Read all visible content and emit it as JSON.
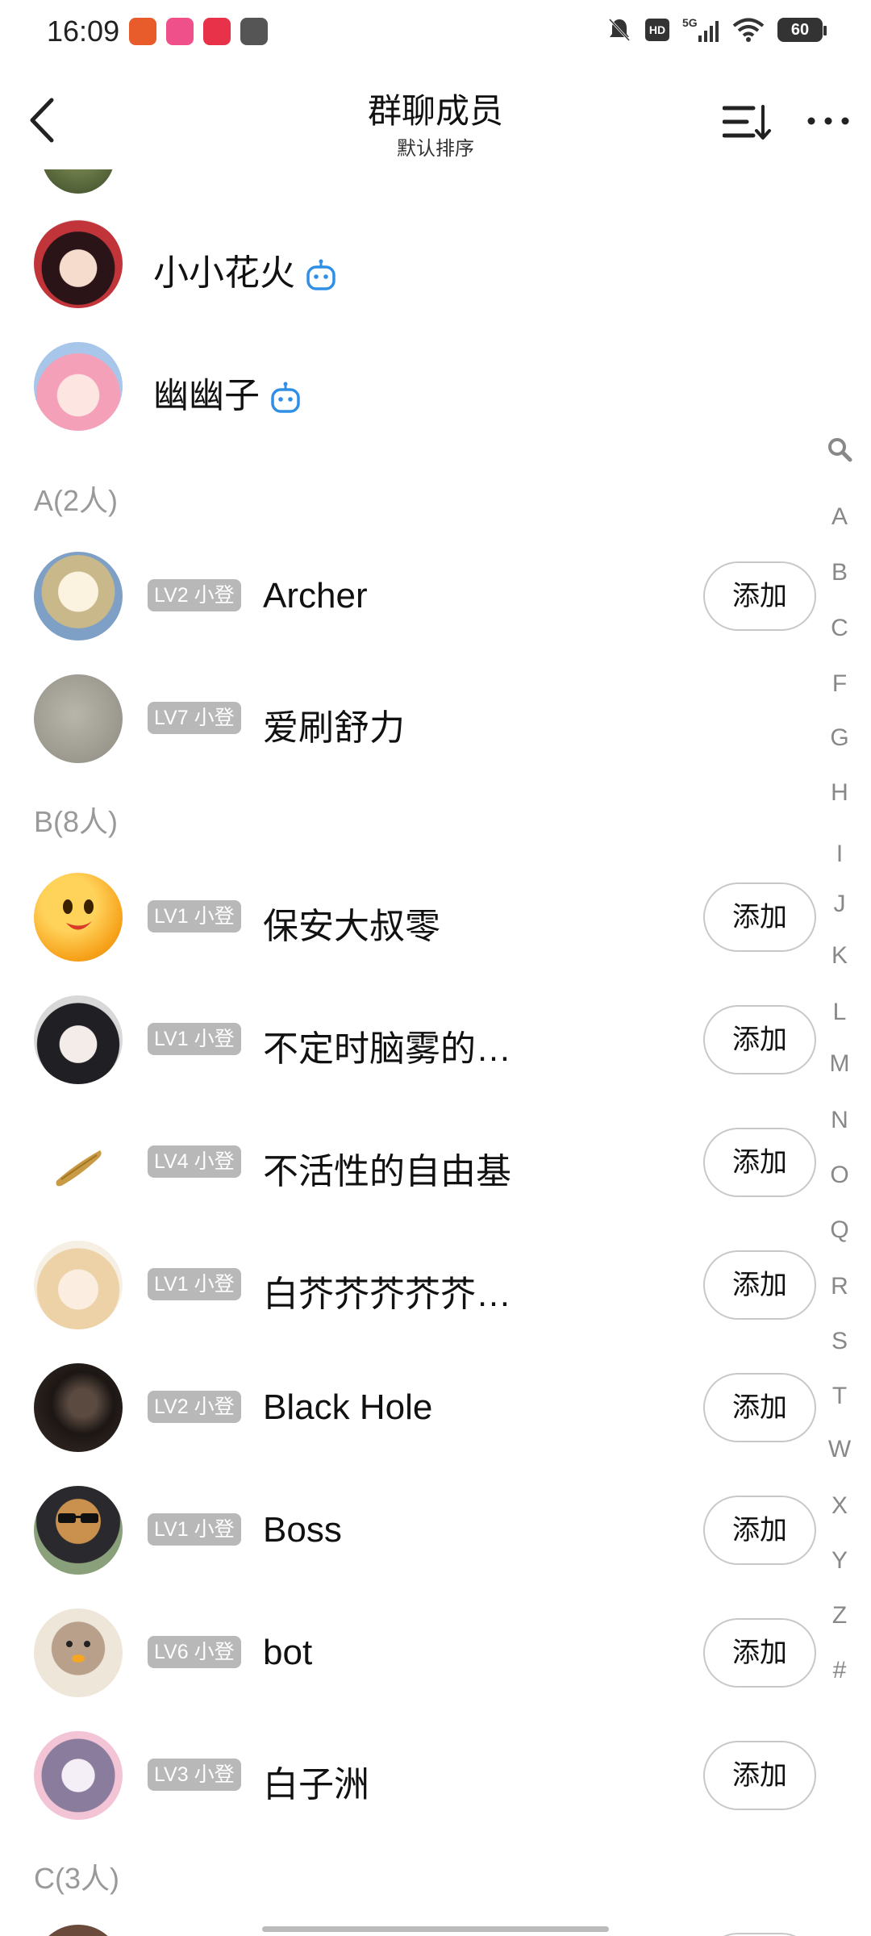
{
  "status": {
    "time": "16:09",
    "battery": "60",
    "network": "5G",
    "hd": "HD"
  },
  "header": {
    "title": "群聊成员",
    "subtitle": "默认排序"
  },
  "members_top": [
    {
      "name": "小小花火",
      "is_bot": true
    },
    {
      "name": "幽幽子",
      "is_bot": true
    }
  ],
  "sections": {
    "A": "A(2人)",
    "B": "B(8人)",
    "C": "C(3人)"
  },
  "members_a": [
    {
      "level": "LV2 小登",
      "name": "Archer",
      "action": "添加"
    },
    {
      "level": "LV7 小登",
      "name": "爱刷舒力"
    }
  ],
  "members_b": [
    {
      "level": "LV1 小登",
      "name": "保安大叔零",
      "action": "添加"
    },
    {
      "level": "LV1 小登",
      "name": "不定时脑雾的…",
      "action": "添加"
    },
    {
      "level": "LV4 小登",
      "name": "不活性的自由基",
      "action": "添加"
    },
    {
      "level": "LV1 小登",
      "name": "白芥芥芥芥芥…",
      "action": "添加"
    },
    {
      "level": "LV2 小登",
      "name": "Black Hole",
      "action": "添加"
    },
    {
      "level": "LV1 小登",
      "name": "Boss",
      "action": "添加"
    },
    {
      "level": "LV6 小登",
      "name": "bot",
      "action": "添加"
    },
    {
      "level": "LV3 小登",
      "name": "白子洲",
      "action": "添加"
    }
  ],
  "index_letters": [
    "A",
    "B",
    "C",
    "F",
    "G",
    "H",
    "I",
    "J",
    "K",
    "L",
    "M",
    "N",
    "O",
    "Q",
    "R",
    "S",
    "T",
    "W",
    "X",
    "Y",
    "Z",
    "#"
  ],
  "colors": {
    "bot_icon": "#2f8fe6",
    "level_badge": "#b8b8b8",
    "section_text": "#999999"
  },
  "icons": {
    "back": "chevron-left-icon",
    "sort": "sort-icon",
    "more": "more-icon",
    "bot": "bot-icon",
    "index_search": "search-icon"
  }
}
